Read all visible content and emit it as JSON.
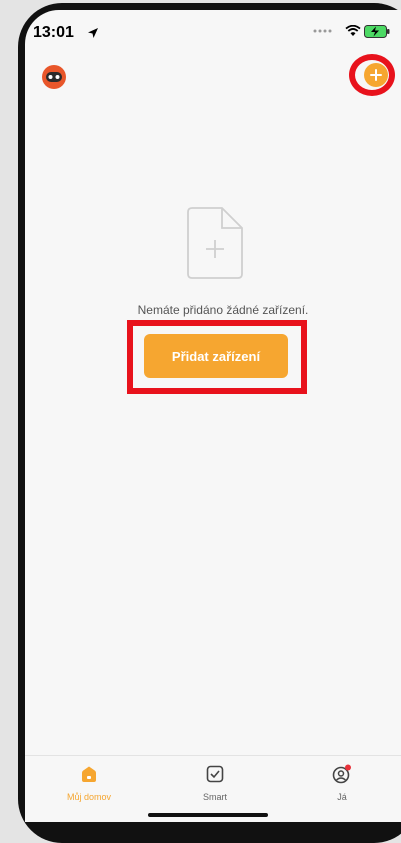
{
  "status_bar": {
    "time": "13:01",
    "icons": [
      "location-arrow-icon",
      "signal-dots-icon",
      "wifi-icon",
      "battery-charging-icon"
    ]
  },
  "header": {
    "avatar_icon": "robot-avatar-icon",
    "add_icon": "plus-circle-icon"
  },
  "empty_state": {
    "icon": "add-document-icon",
    "message": "Nemáte přidáno žádné zařízení.",
    "add_button_label": "Přidat zařízení"
  },
  "tab_bar": {
    "tabs": [
      {
        "label": "Můj domov",
        "icon": "home-icon",
        "active": true
      },
      {
        "label": "Smart",
        "icon": "checkbox-icon",
        "active": false
      },
      {
        "label": "Já",
        "icon": "profile-icon",
        "active": false,
        "badge": true
      }
    ]
  },
  "colors": {
    "accent": "#f6a630",
    "highlight": "#e8121c",
    "badge": "#e8323a"
  }
}
